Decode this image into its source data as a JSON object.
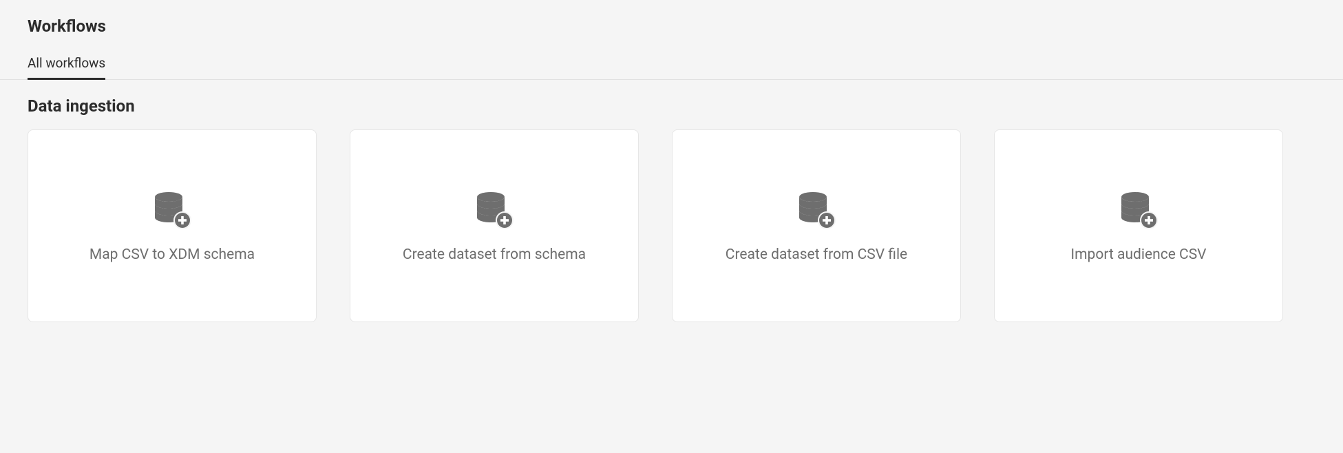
{
  "header": {
    "title": "Workflows"
  },
  "tabs": {
    "items": [
      {
        "label": "All workflows"
      }
    ]
  },
  "section": {
    "title": "Data ingestion"
  },
  "cards": [
    {
      "label": "Map CSV to XDM schema",
      "icon": "database-add-icon"
    },
    {
      "label": "Create dataset from schema",
      "icon": "database-add-icon"
    },
    {
      "label": "Create dataset from CSV file",
      "icon": "database-add-icon"
    },
    {
      "label": "Import audience CSV",
      "icon": "database-add-icon"
    }
  ]
}
